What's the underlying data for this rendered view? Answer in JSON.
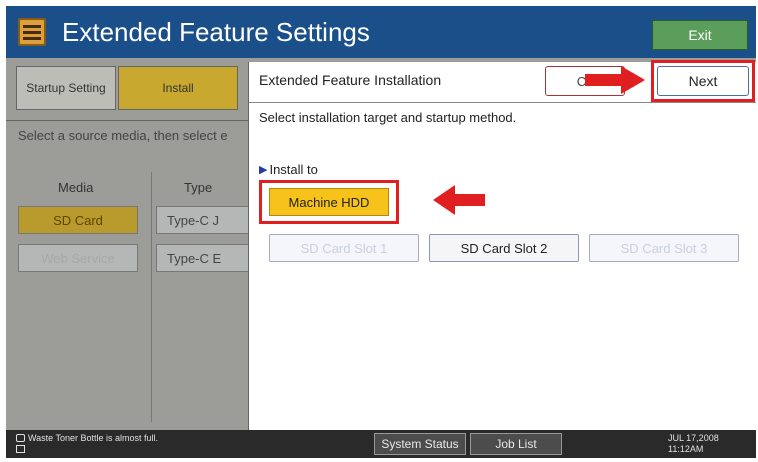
{
  "header": {
    "title": "Extended Feature Settings",
    "exit_label": "Exit",
    "icon": "settings-app-icon"
  },
  "background": {
    "tabs": [
      {
        "label": "Startup Setting"
      },
      {
        "label": "Install"
      }
    ],
    "instruction": "Select a source media, then select e",
    "media_header": "Media",
    "type_header": "Type",
    "media_buttons": [
      {
        "label": "SD Card"
      },
      {
        "label": "Web Service"
      }
    ],
    "type_buttons": [
      {
        "label": "Type-C  J"
      },
      {
        "label": "Type-C  E"
      }
    ]
  },
  "dialog": {
    "title": "Extended Feature Installation",
    "cancel_label": "Ca",
    "next_label": "Next",
    "instruction": "Select installation target and startup method.",
    "install_to_label": "Install to",
    "machine_hdd_label": "Machine HDD",
    "slots": [
      {
        "label": "SD Card Slot 1"
      },
      {
        "label": "SD Card Slot 2"
      },
      {
        "label": "SD Card Slot 3"
      }
    ]
  },
  "status_bar": {
    "message": "Waste Toner Bottle is almost full.",
    "system_status_label": "System Status",
    "job_list_label": "Job List",
    "date": "JUL  17,2008",
    "time": "11:12AM"
  },
  "colors": {
    "header_blue": "#1a4f8a",
    "selected_yellow": "#f7c31a",
    "highlight_red": "#e02020"
  }
}
